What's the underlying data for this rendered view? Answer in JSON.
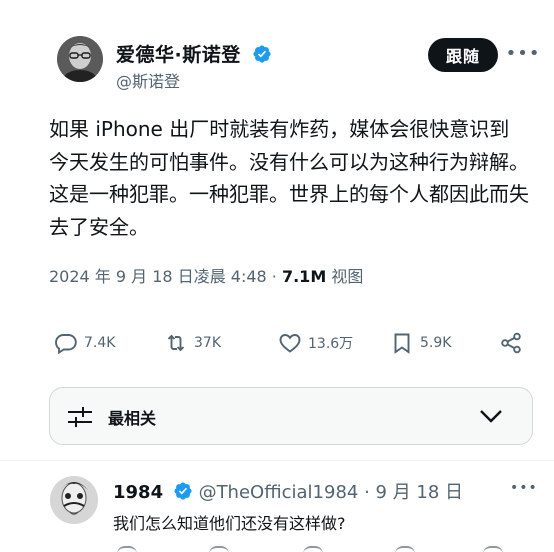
{
  "author": {
    "display_name": "爱德华·斯诺登",
    "handle": "@斯诺登"
  },
  "follow_label": "跟随",
  "more_label": "•••",
  "tweet": {
    "text": "如果 iPhone 出厂时就装有炸药，媒体会很快意识到今天发生的可怕事件。没有什么可以为这种行为辩解。这是一种犯罪。一种犯罪。世界上的每个人都因此而失去了安全。",
    "timestamp": "2024 年 9 月 18 日凌晨 4:48 · ",
    "views_count": "7.1M",
    "views_label": " 视图"
  },
  "actions": {
    "replies": "7.4K",
    "retweets": "37K",
    "likes": "13.6万",
    "bookmarks": "5.9K"
  },
  "sort": {
    "label": "最相关"
  },
  "reply": {
    "name": "1984",
    "handle_date": " @TheOfficial1984 · 9 月 18 日",
    "text": "我们怎么知道他们还没有这样做?",
    "more_label": "•••"
  },
  "colors": {
    "verified": "#1d9bf0",
    "text_primary": "#0f1419",
    "text_secondary": "#536471",
    "follow_bg": "#0f1419"
  }
}
